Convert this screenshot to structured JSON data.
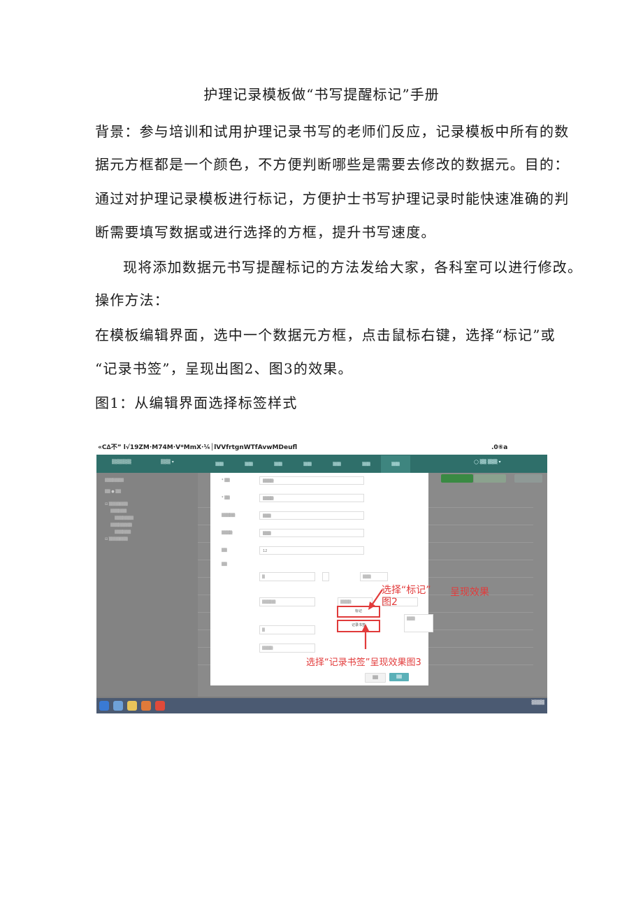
{
  "doc": {
    "title": "护理记录模板做“书写提醒标记”手册",
    "lines": [
      "背景：参与培训和试用护理记录书写的老师们反应，记录模板中所有的数",
      "据元方框都是一个颜色，不方便判断哪些是需要去修改的数据元。目的：",
      "通过对护理记录模板进行标记，方便护士书写护理记录时能快速准确的判",
      "断需要填写数据或进行选择的方框，提升书写速度。",
      "现将添加数据元书写提醒标记的方法发给大家，各科室可以进行修改。",
      "操作方法：",
      "在模板编辑界面，选中一个数据元方框，点击鼠标右键，选择“标记”或",
      "“记录书签”，呈现出图2、图3的效果。",
      "图1：从编辑界面选择标签样式"
    ]
  },
  "screenshot": {
    "titlebar_left": "«C∆不” l√19ZM·M74M·V*MmX·¼│lVVfrtgnWTfAvwMDeufl",
    "titlebar_right": ".0⑥a",
    "menu_selected": "标记",
    "menu_bookmark": "记录书签",
    "annotation_mark_1": "选择“标记”",
    "annotation_mark_2": "呈现效果",
    "annotation_mark_3": "图2",
    "annotation_bookmark": "选择“记录书签”呈现效果图3",
    "seq_value": "12",
    "colors": {
      "nav": "#2f6f6a",
      "annotation": "#e23b3b",
      "confirm": "#5ab0b8"
    }
  }
}
